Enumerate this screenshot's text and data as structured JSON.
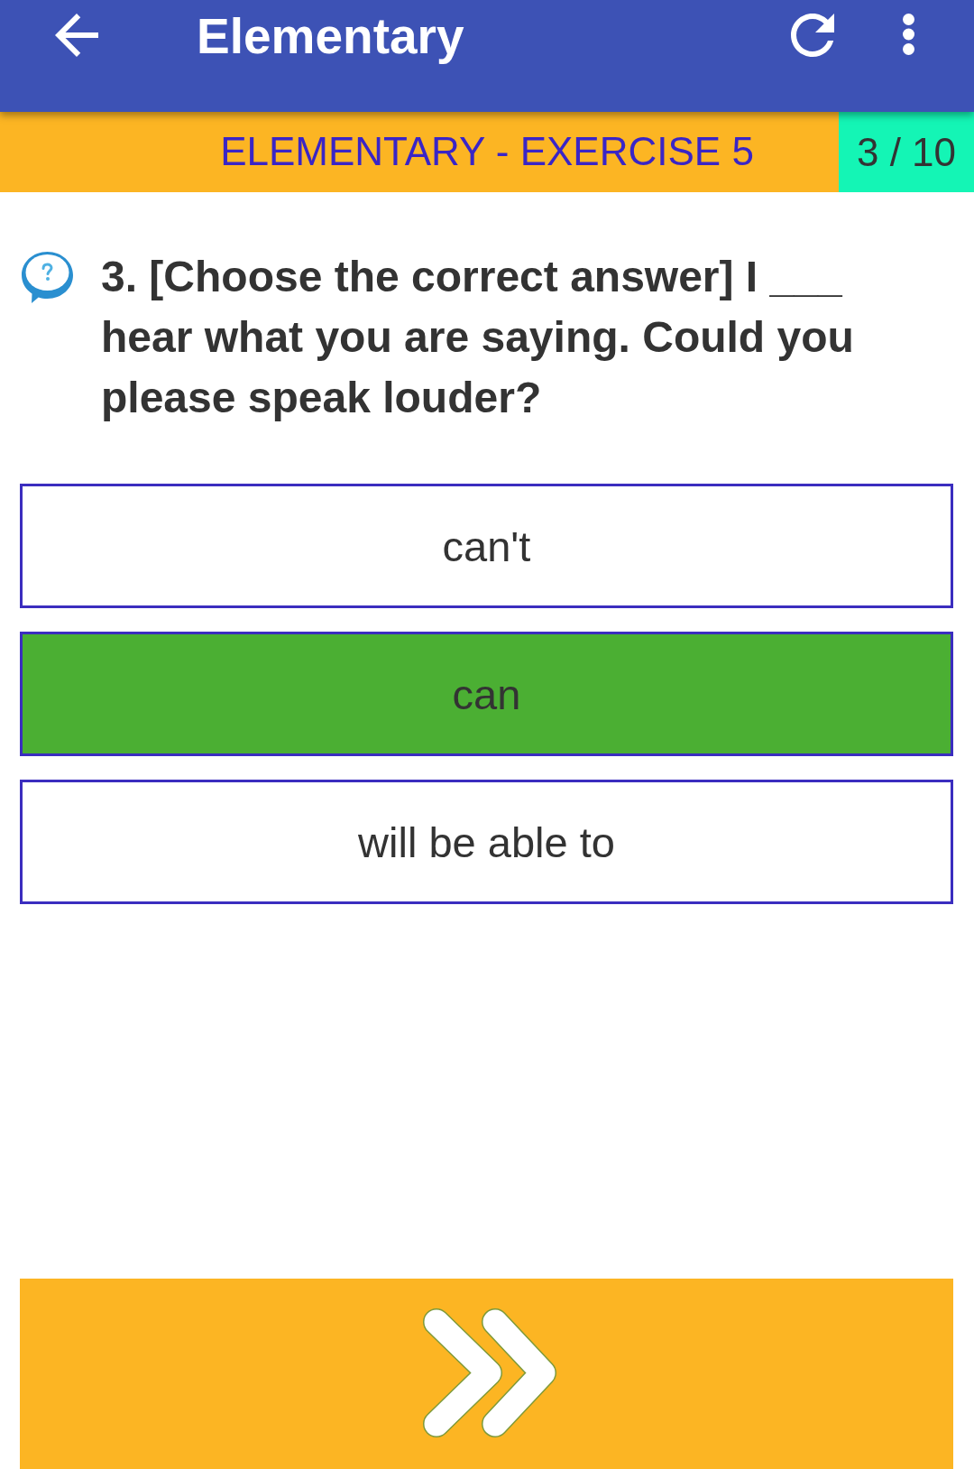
{
  "app_bar": {
    "title": "Elementary"
  },
  "exercise_bar": {
    "title": "ELEMENTARY - EXERCISE 5",
    "progress": "3 / 10"
  },
  "question": {
    "text": "3. [Choose the correct answer] I ___ hear what you are saying. Could you please speak louder?"
  },
  "answers": [
    {
      "label": "can't",
      "selected": false
    },
    {
      "label": "can",
      "selected": true
    },
    {
      "label": "will be able to",
      "selected": false
    }
  ]
}
